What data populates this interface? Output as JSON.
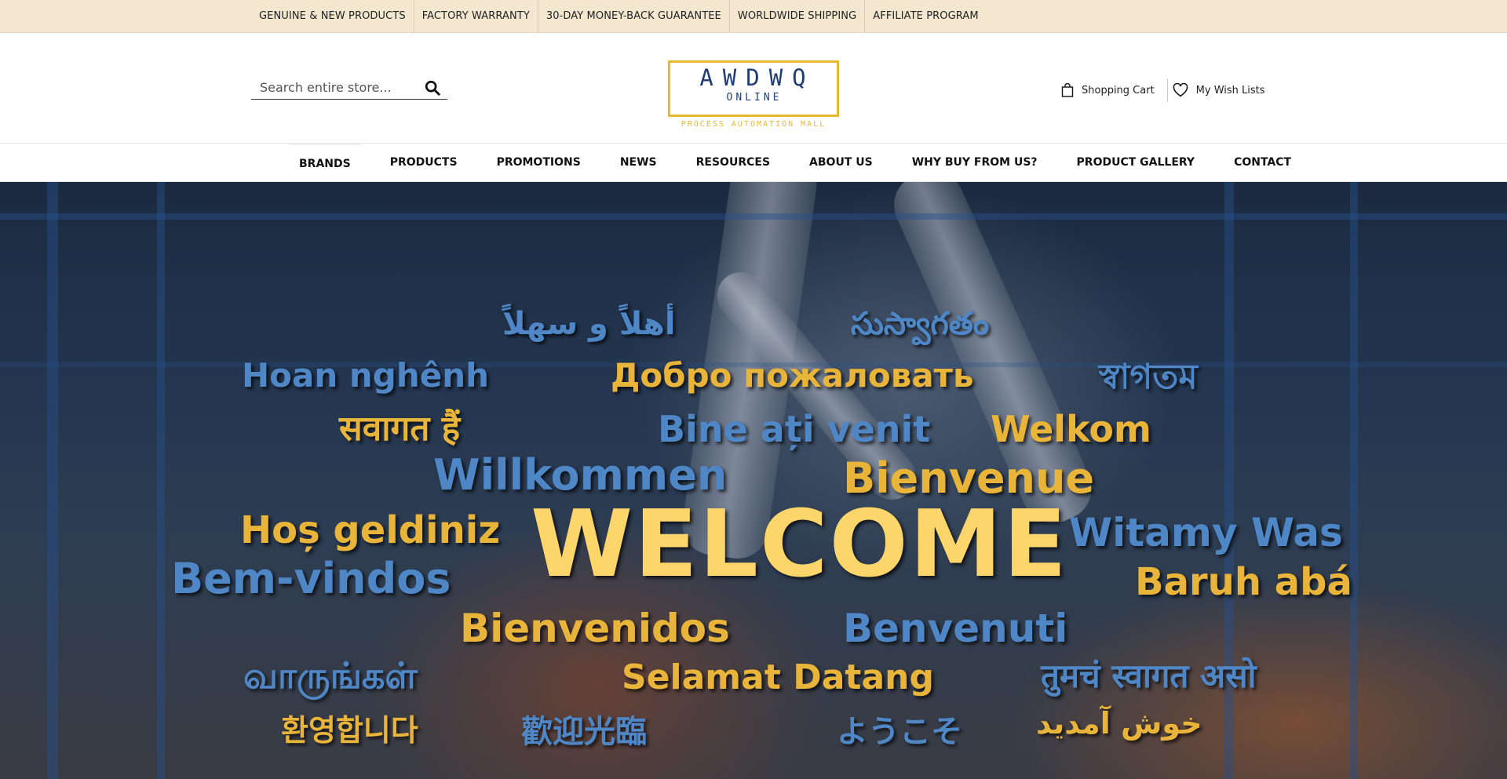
{
  "topbar": {
    "items": [
      "GENUINE & NEW PRODUCTS",
      "FACTORY WARRANTY",
      "30-DAY MONEY-BACK GUARANTEE",
      "WORLDWIDE SHIPPING",
      "AFFILIATE PROGRAM"
    ]
  },
  "header": {
    "search_placeholder": "Search entire store...",
    "logo": {
      "word": "AWDWQ",
      "sub": "ONLINE",
      "tagline": "PROCESS AUTOMATION MALL"
    },
    "cart_label": "Shopping Cart",
    "wishlist_label": "My Wish Lists"
  },
  "nav": {
    "items": [
      "BRANDS",
      "PRODUCTS",
      "PROMOTIONS",
      "NEWS",
      "RESOURCES",
      "ABOUT US",
      "WHY BUY FROM US?",
      "PRODUCT GALLERY",
      "CONTACT"
    ]
  },
  "hero": {
    "words": {
      "arabic": "أهلاً و سهلاً",
      "telugu": "సుస్వాగతం",
      "vietnamese": "Hoan nghênh",
      "russian": "Добро пожаловать",
      "bengali": "স্বাগতম",
      "hindi": "सवागत हैं",
      "romanian": "Bine ați venit",
      "afrikaans": "Welkom",
      "german": "Willkommen",
      "french": "Bienvenue",
      "turkish": "Hoș geldiniz",
      "welcome": "WELCOME",
      "polish": "Witamy Was",
      "portuguese": "Bem-vindos",
      "hebrew": "Baruh abá",
      "spanish": "Bienvenidos",
      "italian": "Benvenuti",
      "tamil": "வாருங்கள்",
      "malay": "Selamat Datang",
      "marathi": "तुमचं स्वागत असो",
      "korean": "환영합니다",
      "chinese": "歡迎光臨",
      "japanese": "ようこそ",
      "persian": "خوش آمدید"
    }
  },
  "colors": {
    "topbar_bg": "#f3e7cf",
    "logo_gold": "#e9b931",
    "logo_navy": "#1f3e78",
    "hero_yellow": "#e9b43a",
    "hero_blue": "#4f86c6"
  }
}
